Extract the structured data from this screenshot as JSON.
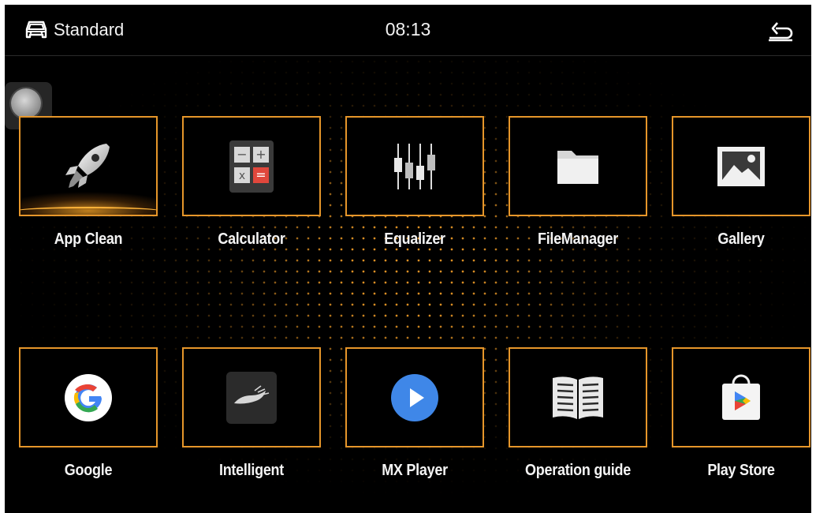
{
  "status_bar": {
    "mode_icon": "car-icon",
    "mode_label": "Standard",
    "time": "08:13",
    "back_icon": "back-arrow-icon"
  },
  "apps": [
    {
      "label": "App Clean",
      "icon": "rocket-icon",
      "selected": true
    },
    {
      "label": "Calculator",
      "icon": "calculator-icon"
    },
    {
      "label": "Equalizer",
      "icon": "equalizer-icon"
    },
    {
      "label": "FileManager",
      "icon": "folder-icon"
    },
    {
      "label": "Gallery",
      "icon": "picture-icon"
    },
    {
      "label": "Google",
      "icon": "google-g-icon"
    },
    {
      "label": "Intelligent",
      "icon": "car-sketch-icon"
    },
    {
      "label": "MX Player",
      "icon": "play-icon"
    },
    {
      "label": "Operation guide",
      "icon": "open-book-icon"
    },
    {
      "label": "Play Store",
      "icon": "play-store-icon"
    }
  ],
  "calculator_keys": [
    "−",
    "+",
    "x",
    "="
  ],
  "colors": {
    "accent": "#e6962a",
    "background": "#000000",
    "google_blue": "#4285f4",
    "google_red": "#ea4335",
    "google_yellow": "#fbbc05",
    "google_green": "#34a853",
    "calc_red": "#e0473c",
    "mx_blue": "#3f87e8"
  }
}
